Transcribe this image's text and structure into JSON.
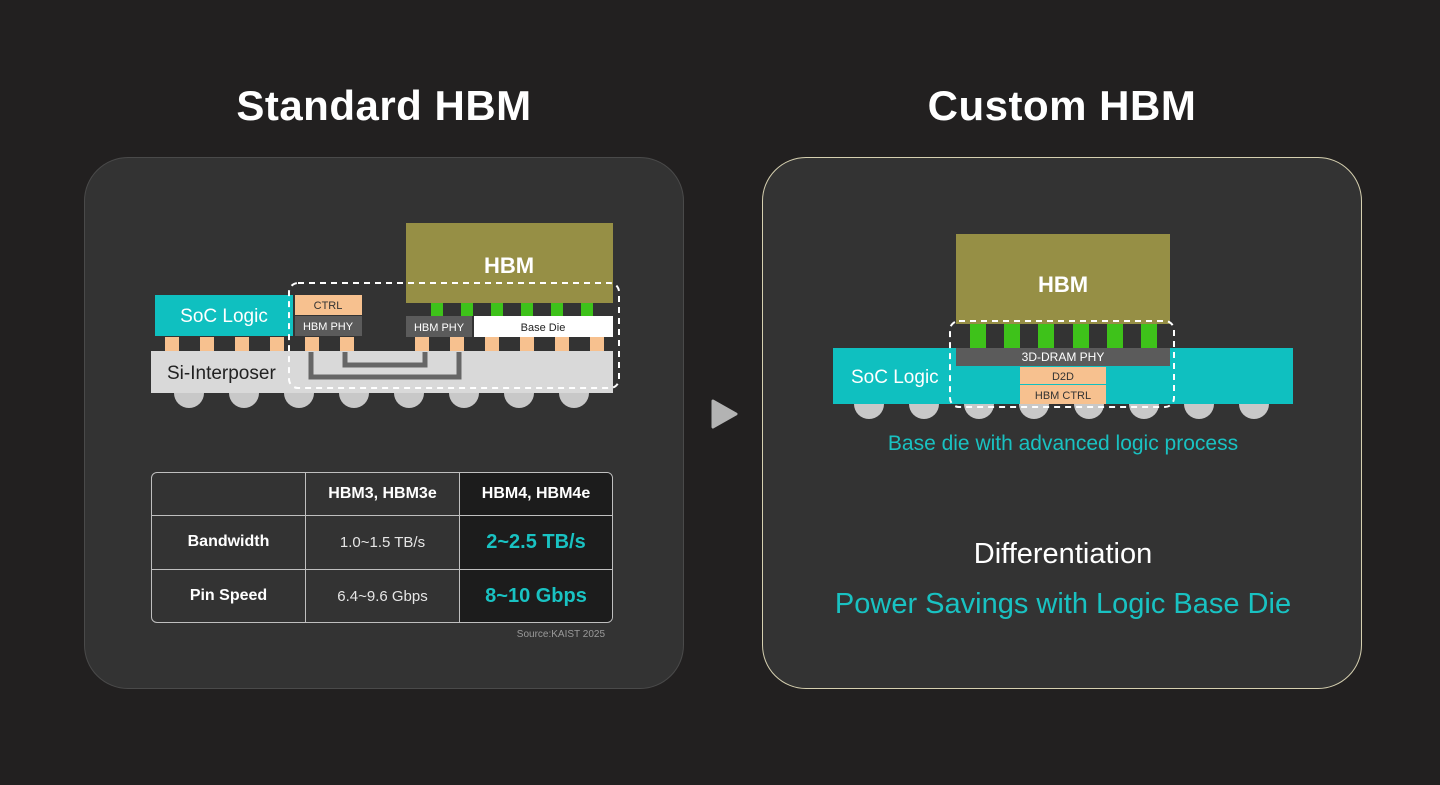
{
  "left": {
    "title": "Standard HBM",
    "labels": {
      "hbm": "HBM",
      "soc_logic": "SoC Logic",
      "ctrl": "CTRL",
      "hbm_phy_soc": "HBM PHY",
      "hbm_phy_base": "HBM PHY",
      "base_die": "Base Die",
      "si_interposer": "Si-Interposer"
    },
    "table": {
      "headers": [
        "",
        "HBM3, HBM3e",
        "HBM4, HBM4e"
      ],
      "rows": [
        {
          "label": "Bandwidth",
          "hbm3": "1.0~1.5 TB/s",
          "hbm4": "2~2.5 TB/s"
        },
        {
          "label": "Pin Speed",
          "hbm3": "6.4~9.6 Gbps",
          "hbm4": "8~10 Gbps"
        }
      ],
      "source": "Source:KAIST 2025"
    }
  },
  "right": {
    "title": "Custom HBM",
    "labels": {
      "hbm": "HBM",
      "soc_logic": "SoC Logic",
      "dram_phy": "3D-DRAM PHY",
      "d2d": "D2D",
      "hbm_ctrl": "HBM CTRL"
    },
    "caption": "Base die with advanced logic process",
    "diff_title": "Differentiation",
    "diff_subtitle": "Power Savings with Logic Base Die"
  },
  "colors": {
    "background": "#222020",
    "panel": "#333333",
    "teal": "#0fc0c0",
    "teal_text": "#19c2c2",
    "olive": "#968f45",
    "green_bump": "#3ec21a",
    "peach": "#f7c18f",
    "gray_dark": "#5b5b5b",
    "gray_light": "#d9d9d9",
    "right_border": "#d6d0b0"
  },
  "icons": {
    "arrow": "play-triangle-icon"
  }
}
